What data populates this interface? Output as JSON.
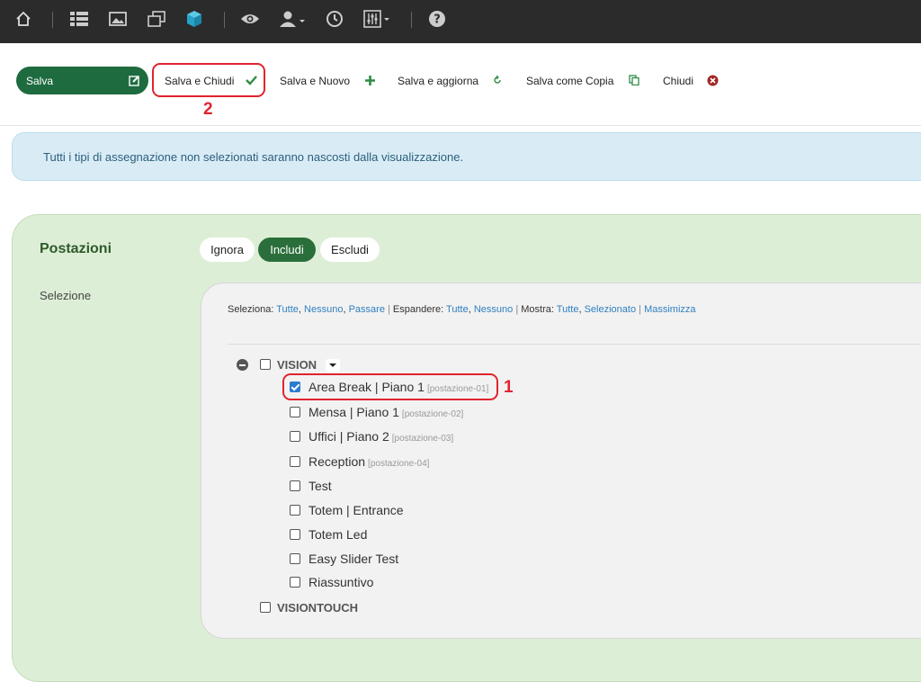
{
  "topbar": {
    "icons": [
      "home-icon",
      "list-icon",
      "image-icon",
      "layers-icon",
      "cube-icon",
      "eye-icon",
      "user-menu-icon",
      "clock-icon",
      "sliders-icon",
      "help-icon"
    ]
  },
  "toolbar": {
    "save_label": "Salva",
    "save_close_label": "Salva e Chiudi",
    "save_new_label": "Salva e Nuovo",
    "save_update_label": "Salva e aggiorna",
    "save_copy_label": "Salva come Copia",
    "close_label": "Chiudi"
  },
  "annotations": {
    "first": "1",
    "second": "2"
  },
  "alert": {
    "text": "Tutti i tipi di assegnazione non selezionati saranno nascosti dalla visualizzazione."
  },
  "panel": {
    "title": "Postazioni",
    "segments": {
      "ignore": "Ignora",
      "include": "Includi",
      "exclude": "Escludi",
      "active": "Includi"
    },
    "selection_label": "Selezione"
  },
  "filters": {
    "select_label": "Seleziona:",
    "select_all": "Tutte",
    "select_none": "Nessuno",
    "select_toggle": "Passare",
    "expand_label": "Espandere:",
    "expand_all": "Tutte",
    "expand_none": "Nessuno",
    "show_label": "Mostra:",
    "show_all": "Tutte",
    "show_selected": "Selezionato",
    "maximize": "Massimizza"
  },
  "tree": {
    "group1": "VISION",
    "items": [
      {
        "label": "Area Break | Piano 1",
        "code": "[postazione-01]",
        "checked": true
      },
      {
        "label": "Mensa | Piano 1",
        "code": "[postazione-02]",
        "checked": false
      },
      {
        "label": "Uffici | Piano 2",
        "code": "[postazione-03]",
        "checked": false
      },
      {
        "label": "Reception",
        "code": "[postazione-04]",
        "checked": false
      },
      {
        "label": "Test",
        "code": "",
        "checked": false
      },
      {
        "label": "Totem | Entrance",
        "code": "",
        "checked": false
      },
      {
        "label": "Totem Led",
        "code": "",
        "checked": false
      },
      {
        "label": "Easy Slider Test",
        "code": "",
        "checked": false
      },
      {
        "label": "Riassuntivo",
        "code": "",
        "checked": false
      }
    ],
    "group2": "VISIONTOUCH"
  },
  "colors": {
    "topbar": "#2b2b2b",
    "primary_green": "#1e6b3f",
    "accent_cube": "#27a3c9",
    "link": "#2f7fc0",
    "annotation": "#e0242f"
  }
}
